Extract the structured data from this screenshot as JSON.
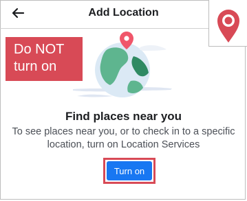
{
  "header": {
    "title": "Add Location",
    "back_icon": "arrow-left-icon"
  },
  "badge": {
    "icon": "map-pin-icon",
    "color": "#d84a56"
  },
  "annotation": {
    "line1": "Do NOT",
    "line2": "turn on",
    "background": "#d84a56"
  },
  "content": {
    "headline": "Find places near you",
    "description": "To see places near you, or to check in to a specific location, turn on Location Services",
    "button_label": "Turn on",
    "button_color": "#1877f2"
  }
}
